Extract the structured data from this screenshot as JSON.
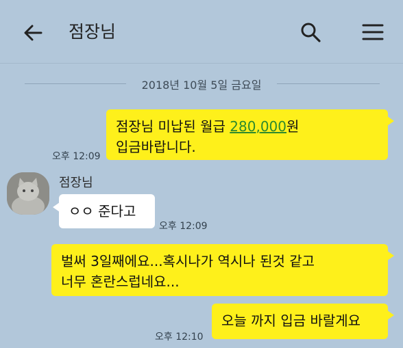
{
  "header": {
    "title": "점장님"
  },
  "icons": {
    "back": "arrow-left-icon",
    "search": "search-icon",
    "menu": "hamburger-menu-icon"
  },
  "date_divider": "2018년 10월 5일 금요일",
  "messages": [
    {
      "from": "me",
      "line1_pre": "점장님 미납된 월급 ",
      "amount_a": "280",
      "amount_sep": ",",
      "amount_b": "000",
      "line1_post": "원",
      "line2": "입금바랍니다.",
      "time": "오후 12:09"
    },
    {
      "from": "점장님",
      "sender": "점장님",
      "text": "ㅇㅇ 준다고",
      "time": "오후 12:09"
    },
    {
      "from": "me",
      "line1": "벌써 3일째에요...혹시나가 역시나 된것 같고",
      "line2": "너무 혼란스럽네요...",
      "time": ""
    },
    {
      "from": "me",
      "text": "오늘 까지 입금 바랄게요",
      "time": "오후 12:10"
    }
  ],
  "colors": {
    "background": "#b2c7da",
    "my_bubble": "#fef01b",
    "other_bubble": "#ffffff",
    "link": "#2d8a2d"
  }
}
